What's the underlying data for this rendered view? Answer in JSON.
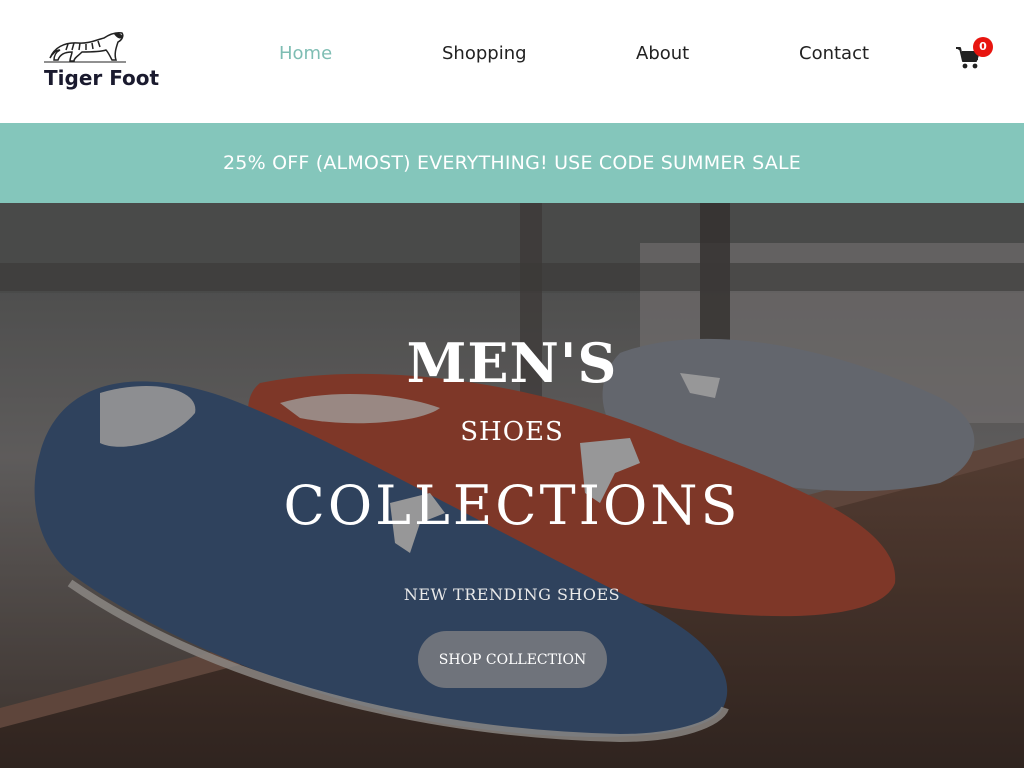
{
  "brand": {
    "name": "Tiger Foot",
    "logo_icon": "tiger-icon"
  },
  "nav": {
    "items": [
      {
        "label": "Home",
        "active": true
      },
      {
        "label": "Shopping",
        "active": false
      },
      {
        "label": "About",
        "active": false
      },
      {
        "label": "Contact",
        "active": false
      }
    ]
  },
  "cart": {
    "icon": "cart-icon",
    "count": "0"
  },
  "promo": {
    "text": "25% OFF (ALMOST) EVERYTHING! USE CODE SUMMER SALE"
  },
  "hero": {
    "title": "MEN'S",
    "subtitle": "SHOES",
    "heading": "COLLECTIONS",
    "tagline": "NEW TRENDING SHOES",
    "button_label": "SHOP COLLECTION"
  },
  "colors": {
    "accent": "#84c6bb",
    "active_nav": "#7ebdb3",
    "badge": "#e8150f",
    "button": "#6f737b"
  }
}
